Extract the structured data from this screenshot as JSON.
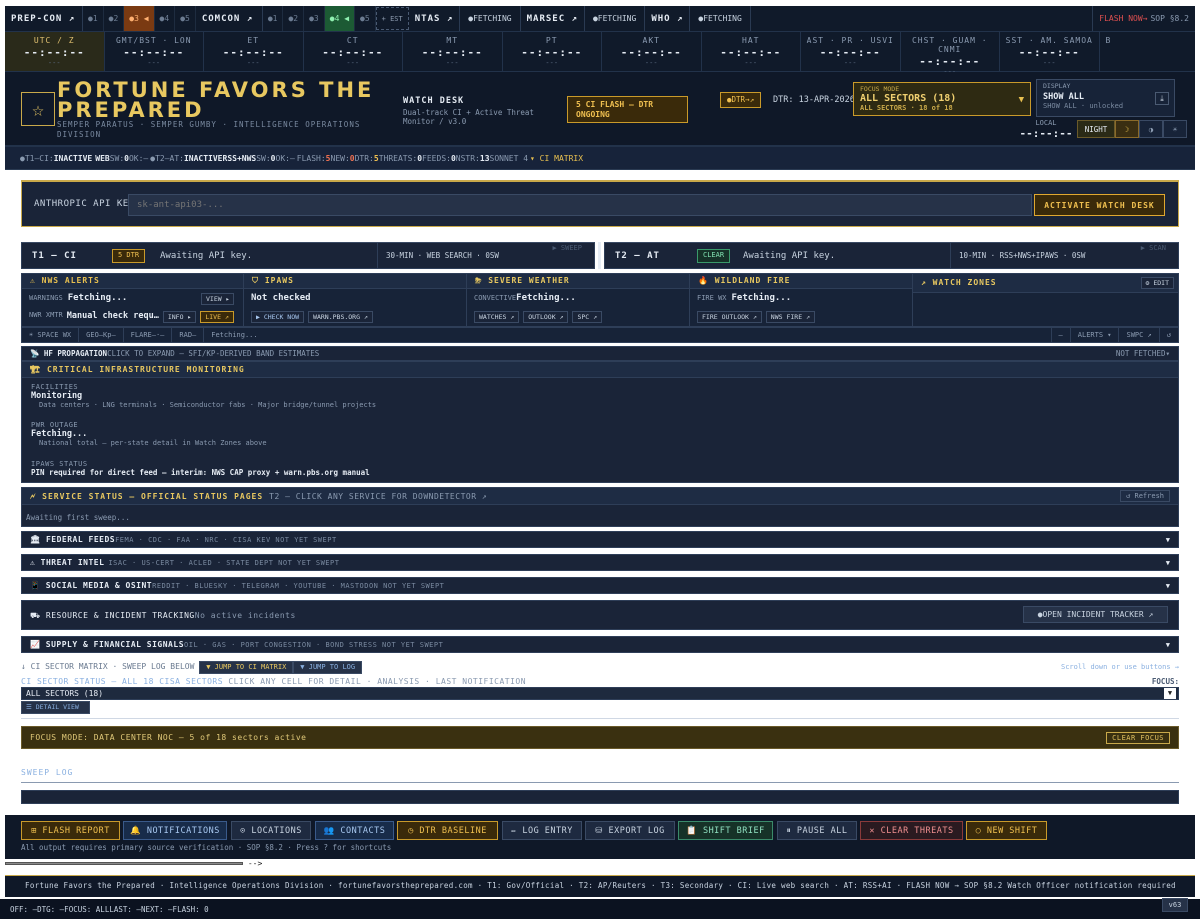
{
  "topbar": {
    "prepcon": "PREP-CON ↗",
    "prepcon_levels": [
      "●1",
      "●2",
      "●3 ◀",
      "●4",
      "●5"
    ],
    "comcon": "COMCON ↗",
    "comcon_levels": [
      "●1",
      "●2",
      "●3",
      "●4 ◀",
      "●5"
    ],
    "est": "+ EST",
    "ntas": "NTAS ↗",
    "ntas_status": "●FETCHING",
    "marsec": "MARSEC ↗",
    "marsec_status": "●FETCHING",
    "who": "WHO ↗",
    "who_status": "●FETCHING",
    "flash": "FLASH NOW→",
    "sop": "SOP §8.2"
  },
  "clocks": [
    {
      "label": "UTC / Z",
      "time": "--:--:--",
      "day": "---"
    },
    {
      "label": "GMT/BST · LON",
      "time": "--:--:--",
      "day": "---"
    },
    {
      "label": "ET",
      "time": "--:--:--",
      "day": "---"
    },
    {
      "label": "CT",
      "time": "--:--:--",
      "day": "---"
    },
    {
      "label": "MT",
      "time": "--:--:--",
      "day": "---"
    },
    {
      "label": "PT",
      "time": "--:--:--",
      "day": "---"
    },
    {
      "label": "AKT",
      "time": "--:--:--",
      "day": "---"
    },
    {
      "label": "HAT",
      "time": "--:--:--",
      "day": "---"
    },
    {
      "label": "AST · PR · USVI",
      "time": "--:--:--",
      "day": "---"
    },
    {
      "label": "CHST · GUAM · CNMI",
      "time": "--:--:--",
      "day": "---"
    },
    {
      "label": "SST · AM. SAMOA",
      "time": "--:--:--",
      "day": "---"
    },
    {
      "label": "B",
      "time": "",
      "day": ""
    }
  ],
  "header": {
    "logo_glyph": "☆",
    "title_line1": "FORTUNE FAVORS THE",
    "title_line2": "PREPARED",
    "subtitle": "SEMPER PARATUS  ·  SEMPER GUMBY  ·  INTELLIGENCE OPERATIONS DIVISION",
    "watch_desk": "WATCH DESK",
    "watch_desc": "Dual-track CI + Active Threat Monitor  /  v3.0",
    "ci_flash": "5 CI FLASH — DTR ONGOING",
    "dtr_button": "●DTR→↗",
    "dtr_date": "DTR: 13-APR-2026",
    "focus_label": "FOCUS MODE",
    "focus_value": "ALL SECTORS (18)",
    "focus_count": "ALL SECTORS · 18 of 18",
    "display_label": "DISPLAY",
    "display_value": "SHOW ALL",
    "display_caption": "SHOW ALL · unlocked",
    "local_label": "LOCAL",
    "local_time": "--:--:--",
    "night": "NIGHT",
    "mode_moon": "☽",
    "mode_half": "◑",
    "mode_sun": "☀"
  },
  "status_strip": {
    "t1": "●T1—CI:",
    "t1_state": "INACTIVE",
    "t1_web": "WEB",
    "t1_sw": "SW:",
    "t1_sw_val": "0",
    "t1_ok": "OK:—",
    "t2": "●T2—AT:",
    "t2_state": "INACTIVE",
    "t2_feeds": "RSS+NWS",
    "t2_sw": "SW:",
    "t2_sw_val": "0",
    "t2_ok": "OK:—",
    "flash": "FLASH:",
    "flash_val": "5",
    "new": "NEW:",
    "new_val": "0",
    "dtr": "DTR:",
    "dtr_val": "5",
    "threats": "THREATS:",
    "threats_val": "0",
    "feeds": "FEEDS:",
    "feeds_val": "0",
    "nstr": "NSTR:",
    "nstr_val": "13",
    "model": "SONNET 4",
    "matrix": "▾ CI MATRIX"
  },
  "api": {
    "label": "ANTHROPIC API KEY",
    "placeholder": "sk-ant-api03-...",
    "activate": "ACTIVATE WATCH DESK"
  },
  "tracks": [
    {
      "name": "T1 — CI",
      "badge": "5 DTR",
      "message": "Awaiting API key.",
      "info": "30-MIN  ·  WEB SEARCH  ·  0SW",
      "action": "▶ SWEEP"
    },
    {
      "name": "T2 — AT",
      "badge": "CLEAR",
      "message": "Awaiting API key.",
      "info": "10-MIN  ·  RSS+NWS+IPAWS  ·  0SW",
      "action": "▶ SCAN"
    }
  ],
  "alerts": {
    "nws": {
      "title": "⚠ NWS ALERTS",
      "row1_label": "WARNINGS",
      "row1_value": "Fetching...",
      "view": "VIEW ▸",
      "row2_label": "NWR XMTR",
      "row2_value": "Manual check requ…",
      "info": "INFO ▸",
      "live": "LIVE ↗"
    },
    "ipaws": {
      "title": "⛉ IPAWS",
      "value": "Not checked",
      "check": "▶ CHECK NOW",
      "warn": "WARN.PBS.ORG ↗"
    },
    "severe": {
      "title": "⛈ SEVERE WEATHER",
      "label": "CONVECTIVE",
      "value": "Fetching...",
      "watches": "WATCHES ↗",
      "outlook": "OUTLOOK ↗",
      "spc": "SPC ↗"
    },
    "fire": {
      "title": "🔥 WILDLAND FIRE",
      "label": "FIRE WX",
      "value": "Fetching...",
      "outlook": "FIRE OUTLOOK ↗",
      "nws": "NWS FIRE ↗"
    },
    "zones": {
      "title": "↗ WATCH ZONES",
      "edit": "⚙ EDIT"
    }
  },
  "spacewx": {
    "label": "☀ SPACE WX",
    "geo": "GEO—Kp—",
    "flare": "FLARE—·—",
    "rad": "RAD—",
    "fetch": "Fetching...",
    "dash": "—",
    "alerts": "ALERTS ▾",
    "swpc": "SWPC ↗",
    "refresh": "↺"
  },
  "hf": {
    "title": "📡 HF PROPAGATION",
    "note": "CLICK TO EXPAND — SFI/KP-DERIVED BAND ESTIMATES",
    "status": "NOT FETCHED▾"
  },
  "cim": {
    "title": "🏗 CRITICAL INFRASTRUCTURE MONITORING",
    "fac_label": "FACILITIES",
    "fac_value": "Monitoring",
    "fac_desc": "Data centers  ·  LNG terminals  ·  Semiconductor fabs  ·  Major bridge/tunnel projects",
    "pwr_label": "PWR OUTAGE",
    "pwr_value": "Fetching...",
    "pwr_desc": "National total — per-state detail in Watch Zones above",
    "ipaws_label": "IPAWS STATUS",
    "ipaws_value": "PIN required for direct feed — interim: NWS CAP proxy + warn.pbs.org manual"
  },
  "service": {
    "title": "🗲 SERVICE STATUS — OFFICIAL STATUS PAGES",
    "sub": "T2 — CLICK ANY SERVICE FOR DOWNDETECTOR ↗",
    "refresh": "↺ Refresh",
    "waiting": "Awaiting first sweep..."
  },
  "sections": [
    {
      "title": "🏛 FEDERAL FEEDS",
      "sub": "FEMA  ·  CDC  ·  FAA  ·  NRC  ·  CISA KEV  NOT YET SWEPT"
    },
    {
      "title": "⚠ THREAT INTEL",
      "sub": "ISAC  ·  US-CERT  ·  ACLED  ·  STATE DEPT  NOT YET SWEPT"
    },
    {
      "title": "📱 SOCIAL MEDIA & OSINT",
      "sub": "REDDIT  ·  BLUESKY  ·  TELEGRAM  ·  YOUTUBE  ·  MASTODON  NOT YET SWEPT"
    },
    {
      "title": "📈 SUPPLY & FINANCIAL SIGNALS",
      "sub": "OIL  ·  GAS  ·  PORT CONGESTION  ·  BOND STRESS  NOT YET SWEPT"
    }
  ],
  "chevron": "▼",
  "resource": {
    "title": "⛟ RESOURCE & INCIDENT TRACKING",
    "sub": "No active incidents",
    "button": "●OPEN INCIDENT TRACKER ↗"
  },
  "matrix": {
    "line": "↓ CI SECTOR MATRIX  ·  SWEEP LOG BELOW",
    "jump_ci": "▼ JUMP TO CI MATRIX",
    "jump_log": "▼ JUMP TO LOG",
    "scroll": "Scroll down or use buttons →",
    "sector_title": "CI SECTOR STATUS — ALL 18 CISA SECTORS",
    "sector_sub": " CLICK ANY CELL FOR DETAIL  ·  ANALYSIS  ·  LAST NOTIFICATION",
    "focus": "FOCUS:",
    "all_sectors": "ALL SECTORS (18)",
    "detail": "☰ DETAIL VIEW"
  },
  "focusmode": {
    "text": "FOCUS MODE: DATA CENTER NOC — 5 of 18 sectors active",
    "clear": "CLEAR FOCUS"
  },
  "sweeplog": "SWEEP LOG",
  "actions": [
    {
      "label": "⊞ FLASH REPORT",
      "style": "gold"
    },
    {
      "label": "🔔 NOTIFICATIONS",
      "style": "blue"
    },
    {
      "label": "⊙ LOCATIONS",
      "style": ""
    },
    {
      "label": "👥 CONTACTS",
      "style": "blue"
    },
    {
      "label": "◷ DTR BASELINE",
      "style": "gold"
    },
    {
      "label": "✏ LOG ENTRY",
      "style": ""
    },
    {
      "label": "⛁ EXPORT LOG",
      "style": ""
    },
    {
      "label": "📋 SHIFT BRIEF",
      "style": "green"
    },
    {
      "label": "⏸ PAUSE ALL",
      "style": ""
    },
    {
      "label": "✕ CLEAR THREATS",
      "style": "red"
    },
    {
      "label": "○ NEW SHIFT",
      "style": "gold"
    }
  ],
  "action_note": "All output requires primary source verification  ·  SOP §8.2  ·  Press ? for shortcuts",
  "arrow_text": "-->",
  "footer": "Fortune Favors the Prepared   ·   Intelligence Operations Division   ·   fortunefavorstheprepared.com   ·   T1: Gov/Official   ·   T2: AP/Reuters   ·   T3: Secondary   ·   CI: Live web search   ·   AT: RSS+AI   ·   FLASH NOW → SOP §8.2 Watch Officer notification required",
  "bottombar": "OFF: —DTG: —FOCUS: ALLLAST: —NEXT: —FLASH: 0",
  "version": "v63"
}
